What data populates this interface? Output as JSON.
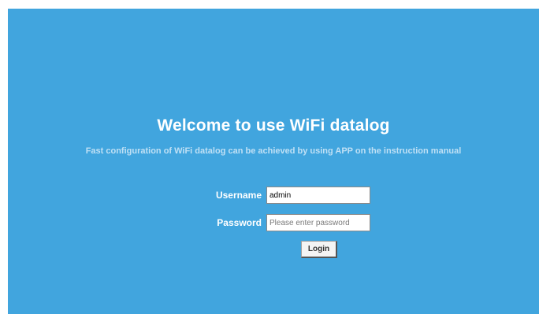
{
  "page": {
    "title": "Welcome to use WiFi datalog",
    "subtitle": "Fast configuration of WiFi datalog can be achieved by using APP on the instruction manual",
    "background_color": "#41a5de"
  },
  "login_form": {
    "username_label": "Username",
    "username_value": "admin",
    "password_label": "Password",
    "password_placeholder": "Please enter password",
    "login_label": "Login"
  }
}
